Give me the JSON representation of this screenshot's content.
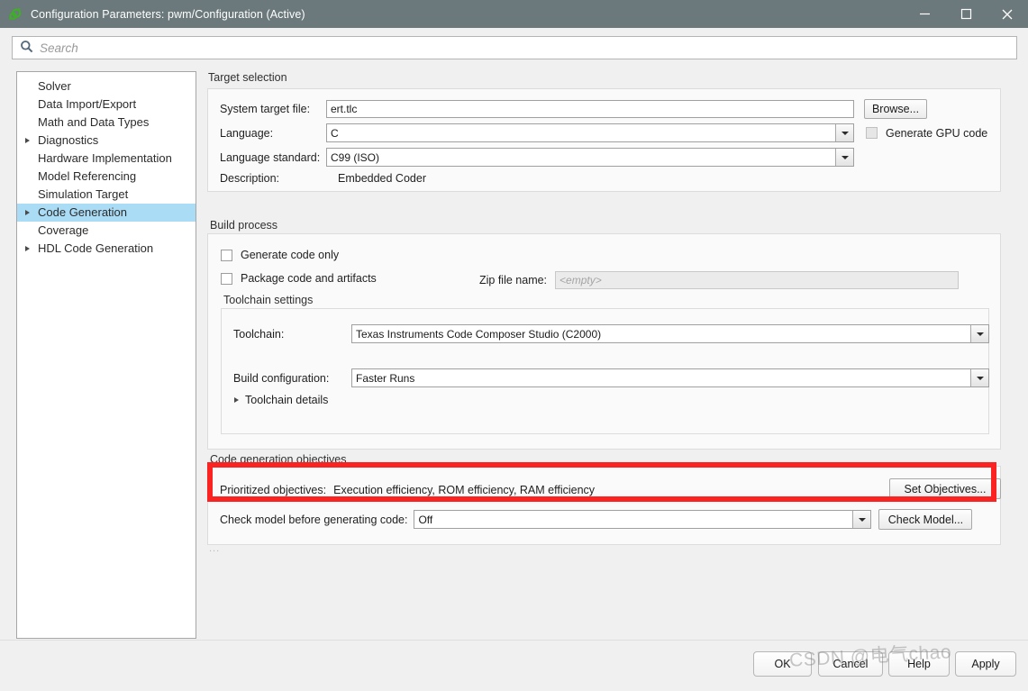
{
  "window": {
    "title": "Configuration Parameters: pwm/Configuration (Active)",
    "app_icon": "simulink-gear-icon",
    "titlebar_color": "#6b787c",
    "controls": {
      "minimize": "minimize-icon",
      "maximize": "maximize-icon",
      "close": "close-icon"
    }
  },
  "search": {
    "icon": "search-icon",
    "placeholder": "Search",
    "value": ""
  },
  "sidebar": {
    "items": [
      {
        "label": "Solver",
        "expandable": false,
        "selected": false
      },
      {
        "label": "Data Import/Export",
        "expandable": false,
        "selected": false
      },
      {
        "label": "Math and Data Types",
        "expandable": false,
        "selected": false
      },
      {
        "label": "Diagnostics",
        "expandable": true,
        "selected": false
      },
      {
        "label": "Hardware Implementation",
        "expandable": false,
        "selected": false
      },
      {
        "label": "Model Referencing",
        "expandable": false,
        "selected": false
      },
      {
        "label": "Simulation Target",
        "expandable": false,
        "selected": false
      },
      {
        "label": "Code Generation",
        "expandable": true,
        "selected": true
      },
      {
        "label": "Coverage",
        "expandable": false,
        "selected": false
      },
      {
        "label": "HDL Code Generation",
        "expandable": true,
        "selected": false
      }
    ],
    "selection_color": "#aadcf5"
  },
  "target_selection": {
    "section_label": "Target selection",
    "system_target_file": {
      "label": "System target file:",
      "value": "ert.tlc"
    },
    "browse_button": "Browse...",
    "language": {
      "label": "Language:",
      "value": "C"
    },
    "generate_gpu_code": {
      "label": "Generate GPU code",
      "checked": false,
      "enabled": false
    },
    "language_standard": {
      "label": "Language standard:",
      "value": "C99 (ISO)"
    },
    "description": {
      "label": "Description:",
      "value": "Embedded Coder"
    }
  },
  "build_process": {
    "section_label": "Build process",
    "generate_code_only": {
      "label": "Generate code only",
      "checked": false
    },
    "package_code_and_artifacts": {
      "label": "Package code and artifacts",
      "checked": false
    },
    "zip_file_name": {
      "label": "Zip file name:",
      "value": "<empty>",
      "enabled": false
    },
    "toolchain_settings": {
      "section_label": "Toolchain settings",
      "toolchain": {
        "label": "Toolchain:",
        "value": "Texas Instruments Code Composer Studio (C2000)"
      },
      "build_configuration": {
        "label": "Build configuration:",
        "value": "Faster Runs"
      },
      "toolchain_details": {
        "label": "Toolchain details",
        "expanded": false
      }
    }
  },
  "code_generation_objectives": {
    "section_label": "Code generation objectives",
    "prioritized_objectives": {
      "label": "Prioritized objectives:",
      "value": "Execution efficiency, ROM efficiency, RAM efficiency"
    },
    "set_objectives_button": "Set Objectives...",
    "check_model_before_generating_code": {
      "label": "Check model before generating code:",
      "value": "Off"
    },
    "check_model_button": "Check Model...",
    "highlight_color": "#fb2222"
  },
  "overflow_indicator": "...",
  "footer": {
    "ok": "OK",
    "cancel": "Cancel",
    "help": "Help",
    "apply": "Apply"
  },
  "watermark": "CSDN @电气chao"
}
